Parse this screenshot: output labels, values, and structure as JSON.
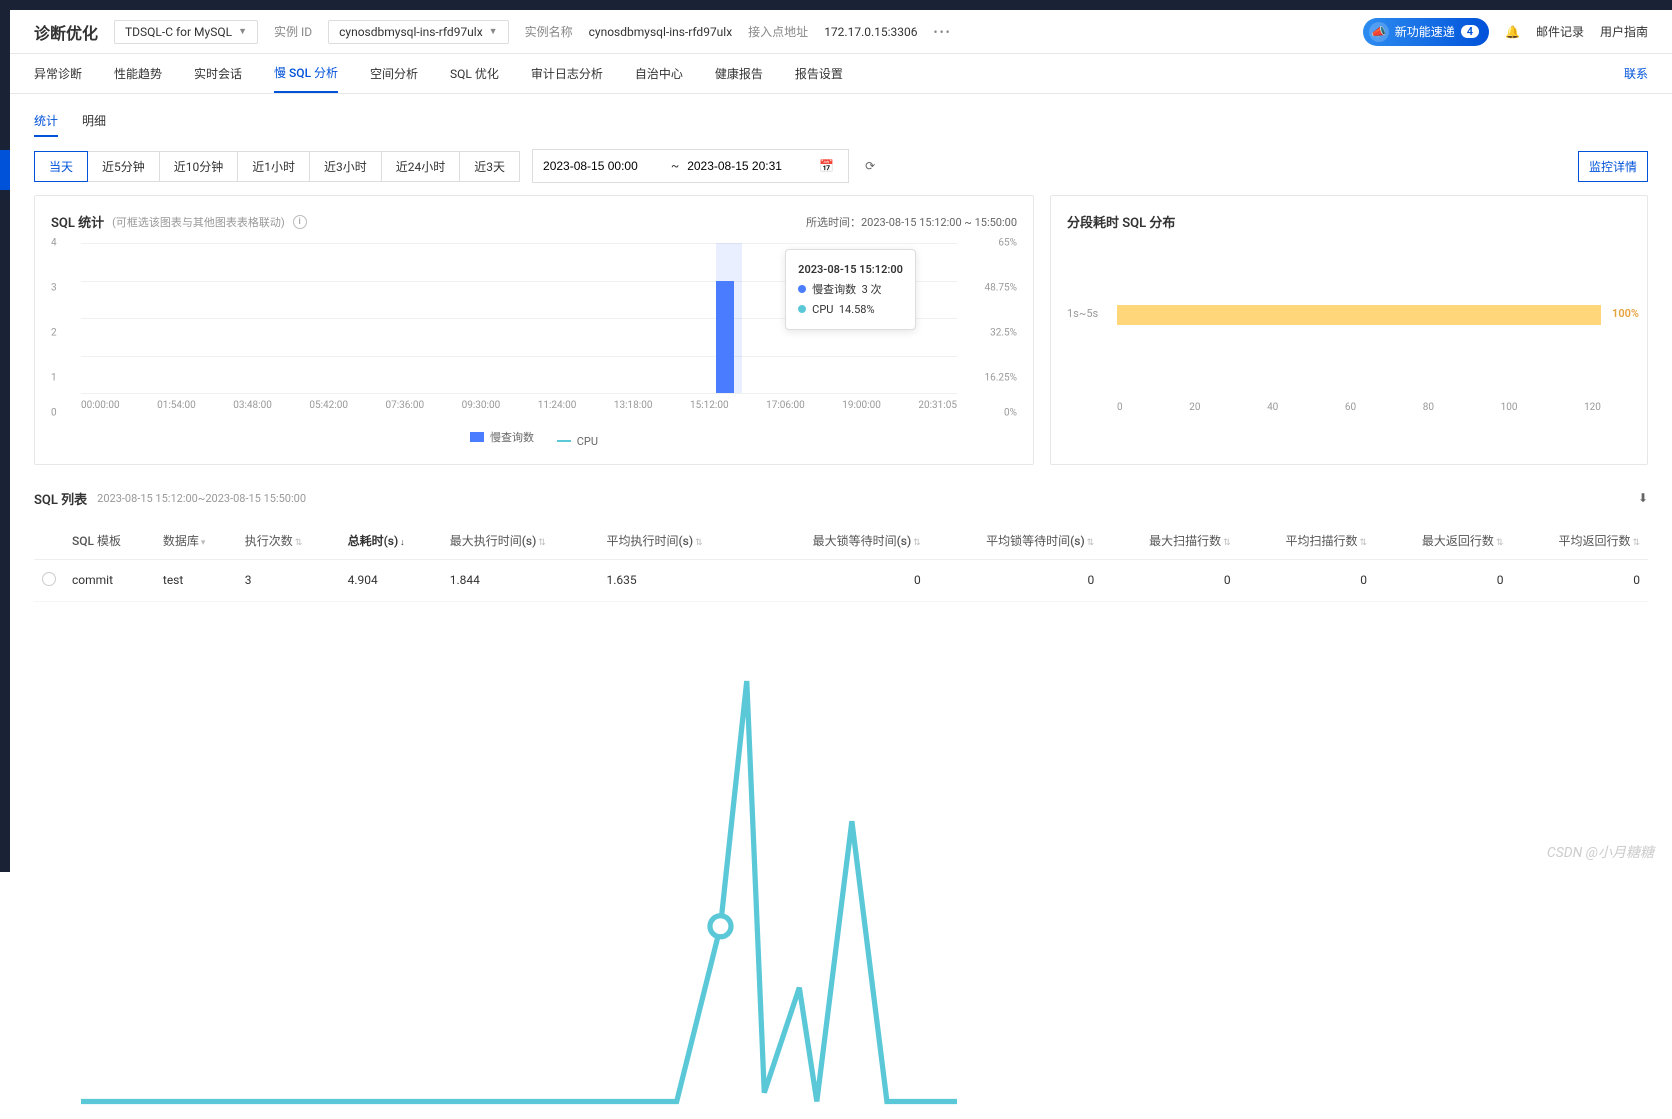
{
  "header": {
    "page_title": "诊断优化",
    "db_type": "TDSQL-C for MySQL",
    "instance_id_label": "实例 ID",
    "instance_id_value": "cynosdbmysql-ins-rfd97ulx",
    "instance_name_label": "实例名称",
    "instance_name_value": "cynosdbmysql-ins-rfd97ulx",
    "endpoint_label": "接入点地址",
    "endpoint_value": "172.17.0.15:3306",
    "new_feature_label": "新功能速递",
    "new_feature_count": "4",
    "mail_label": "邮件记录",
    "user_label": "用户指南"
  },
  "nav": {
    "tabs": [
      "异常诊断",
      "性能趋势",
      "实时会话",
      "慢 SQL 分析",
      "空间分析",
      "SQL 优化",
      "审计日志分析",
      "自治中心",
      "健康报告",
      "报告设置"
    ],
    "active_index": 3,
    "right_link": "联系"
  },
  "sub": {
    "tabs": [
      "统计",
      "明细"
    ],
    "active_index": 0
  },
  "toolbar": {
    "ranges": [
      "当天",
      "近5分钟",
      "近10分钟",
      "近1小时",
      "近3小时",
      "近24小时",
      "近3天"
    ],
    "active_range": 0,
    "date_from": "2023-08-15 00:00",
    "date_to": "2023-08-15 20:31",
    "date_sep": "~",
    "monitor_btn": "监控详情"
  },
  "stats_panel": {
    "title": "SQL 统计",
    "hint": "(可框选该图表与其他图表表格联动)",
    "selected_label": "所选时间：",
    "selected_range": "2023-08-15 15:12:00 ~ 15:50:00",
    "legend_slow": "慢查询数",
    "legend_cpu": "CPU",
    "tooltip": {
      "time": "2023-08-15 15:12:00",
      "slow_label": "慢查询数",
      "slow_value": "3 次",
      "cpu_label": "CPU",
      "cpu_value": "14.58%"
    }
  },
  "dist_panel": {
    "title": "分段耗时 SQL 分布",
    "bucket_label": "1s~5s",
    "bucket_value": "100%"
  },
  "table": {
    "title": "SQL 列表",
    "range_text": "2023-08-15 15:12:00~2023-08-15 15:50:00",
    "columns": {
      "sql_template": "SQL 模板",
      "database": "数据库",
      "exec_count": "执行次数",
      "total_time": "总耗时(s)",
      "max_exec": "最大执行时间(s)",
      "avg_exec": "平均执行时间(s)",
      "max_lock": "最大锁等待时间(s)",
      "avg_lock": "平均锁等待时间(s)",
      "max_scan": "最大扫描行数",
      "avg_scan": "平均扫描行数",
      "max_return": "最大返回行数",
      "avg_return": "平均返回行数"
    },
    "rows": [
      {
        "sql_template": "commit",
        "database": "test",
        "exec_count": "3",
        "total_time": "4.904",
        "max_exec": "1.844",
        "avg_exec": "1.635",
        "max_lock": "0",
        "avg_lock": "0",
        "max_scan": "0",
        "avg_scan": "0",
        "max_return": "0",
        "avg_return": "0"
      }
    ]
  },
  "chart_data": [
    {
      "type": "bar",
      "title": "SQL 统计",
      "x_ticks": [
        "00:00:00",
        "01:54:00",
        "03:48:00",
        "05:42:00",
        "07:36:00",
        "09:30:00",
        "11:24:00",
        "13:18:00",
        "15:12:00",
        "17:06:00",
        "19:00:00",
        "20:31:05"
      ],
      "y_left_ticks": [
        0,
        1,
        2,
        3,
        4
      ],
      "y_right_ticks": [
        "0%",
        "16.25%",
        "32.5%",
        "48.75%",
        "65%"
      ],
      "series": [
        {
          "name": "慢查询数",
          "axis": "left",
          "type": "bar",
          "points": [
            {
              "x": "15:12:00",
              "y": 3
            }
          ]
        },
        {
          "name": "CPU",
          "axis": "right",
          "type": "line",
          "unit": "%",
          "approx_points": [
            {
              "x": "00:00:00",
              "y": 1
            },
            {
              "x": "14:00:00",
              "y": 1
            },
            {
              "x": "15:12:00",
              "y": 14.58
            },
            {
              "x": "15:40:00",
              "y": 32
            },
            {
              "x": "16:10:00",
              "y": 2
            },
            {
              "x": "17:06:00",
              "y": 10
            },
            {
              "x": "17:30:00",
              "y": 1
            },
            {
              "x": "18:20:00",
              "y": 22
            },
            {
              "x": "19:00:00",
              "y": 1
            },
            {
              "x": "20:31:05",
              "y": 1
            }
          ]
        }
      ]
    },
    {
      "type": "bar",
      "title": "分段耗时 SQL 分布",
      "orientation": "horizontal",
      "categories": [
        "1s~5s"
      ],
      "values": [
        100
      ],
      "unit": "%",
      "x_ticks": [
        0,
        20,
        40,
        60,
        80,
        100,
        120
      ]
    }
  ],
  "watermark": "CSDN @小月糖糖"
}
